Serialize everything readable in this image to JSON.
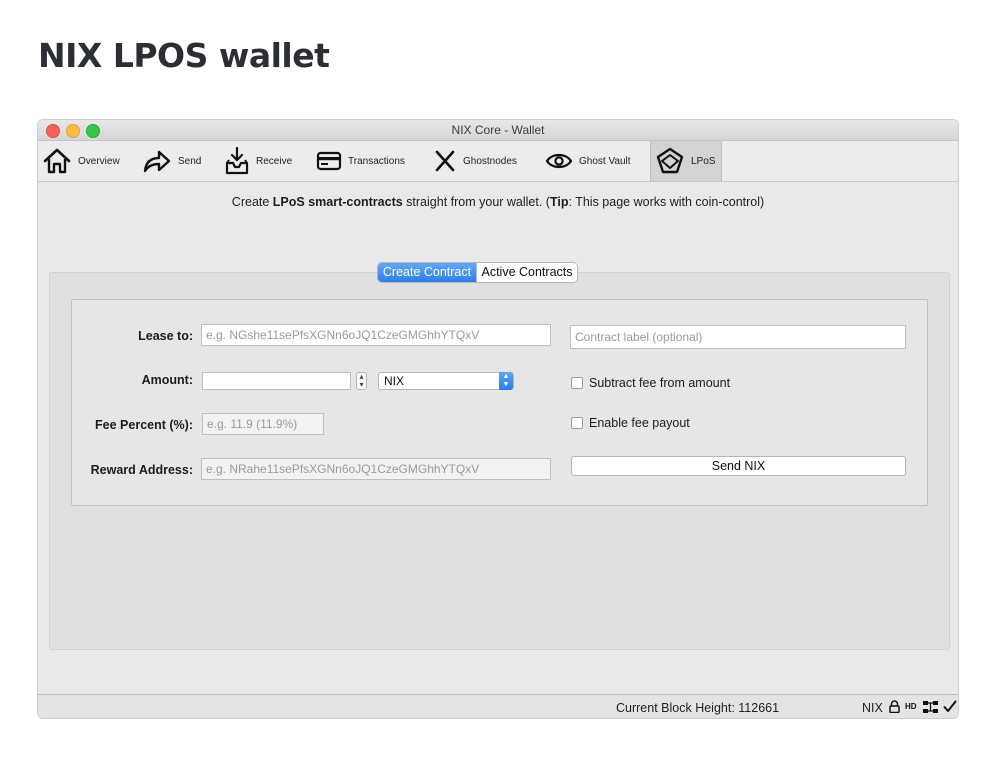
{
  "page": {
    "heading": "NIX LPOS wallet"
  },
  "window": {
    "title": "NIX Core - Wallet"
  },
  "toolbar": {
    "items": [
      {
        "label": "Overview",
        "icon": "home-icon"
      },
      {
        "label": "Send",
        "icon": "send-arrow-icon"
      },
      {
        "label": "Receive",
        "icon": "receive-inbox-icon"
      },
      {
        "label": "Transactions",
        "icon": "transactions-card-icon"
      },
      {
        "label": "Ghostnodes",
        "icon": "ghostnodes-x-icon"
      },
      {
        "label": "Ghost Vault",
        "icon": "eye-icon"
      },
      {
        "label": "LPoS",
        "icon": "lpos-logo-icon",
        "active": true
      }
    ]
  },
  "tip": {
    "pre": "Create ",
    "bold1": "LPoS smart-contracts",
    "mid": " straight from your wallet. (",
    "bold2": "Tip",
    "post": ": This page works with coin-control)"
  },
  "tabs": {
    "create": "Create Contract",
    "active": "Active Contracts"
  },
  "form": {
    "lease_label": "Lease to:",
    "lease_placeholder": "e.g. NGshe11sePfsXGNn6oJQ1CzeGMGhhYTQxV",
    "contract_label_placeholder": "Contract label (optional)",
    "amount_label": "Amount:",
    "amount_value": "",
    "unit_selected": "NIX",
    "subtract_fee_label": "Subtract fee from amount",
    "fee_percent_label": "Fee Percent (%):",
    "fee_percent_placeholder": "e.g. 11.9 (11.9%)",
    "enable_fee_payout_label": "Enable fee payout",
    "reward_label": "Reward Address:",
    "reward_placeholder": "e.g. NRahe11sePfsXGNn6oJQ1CzeGMGhhYTQxV",
    "send_button": "Send NIX"
  },
  "status": {
    "block_height": "Current Block Height: 112661",
    "unit": "NIX",
    "hd_label": "HD"
  }
}
